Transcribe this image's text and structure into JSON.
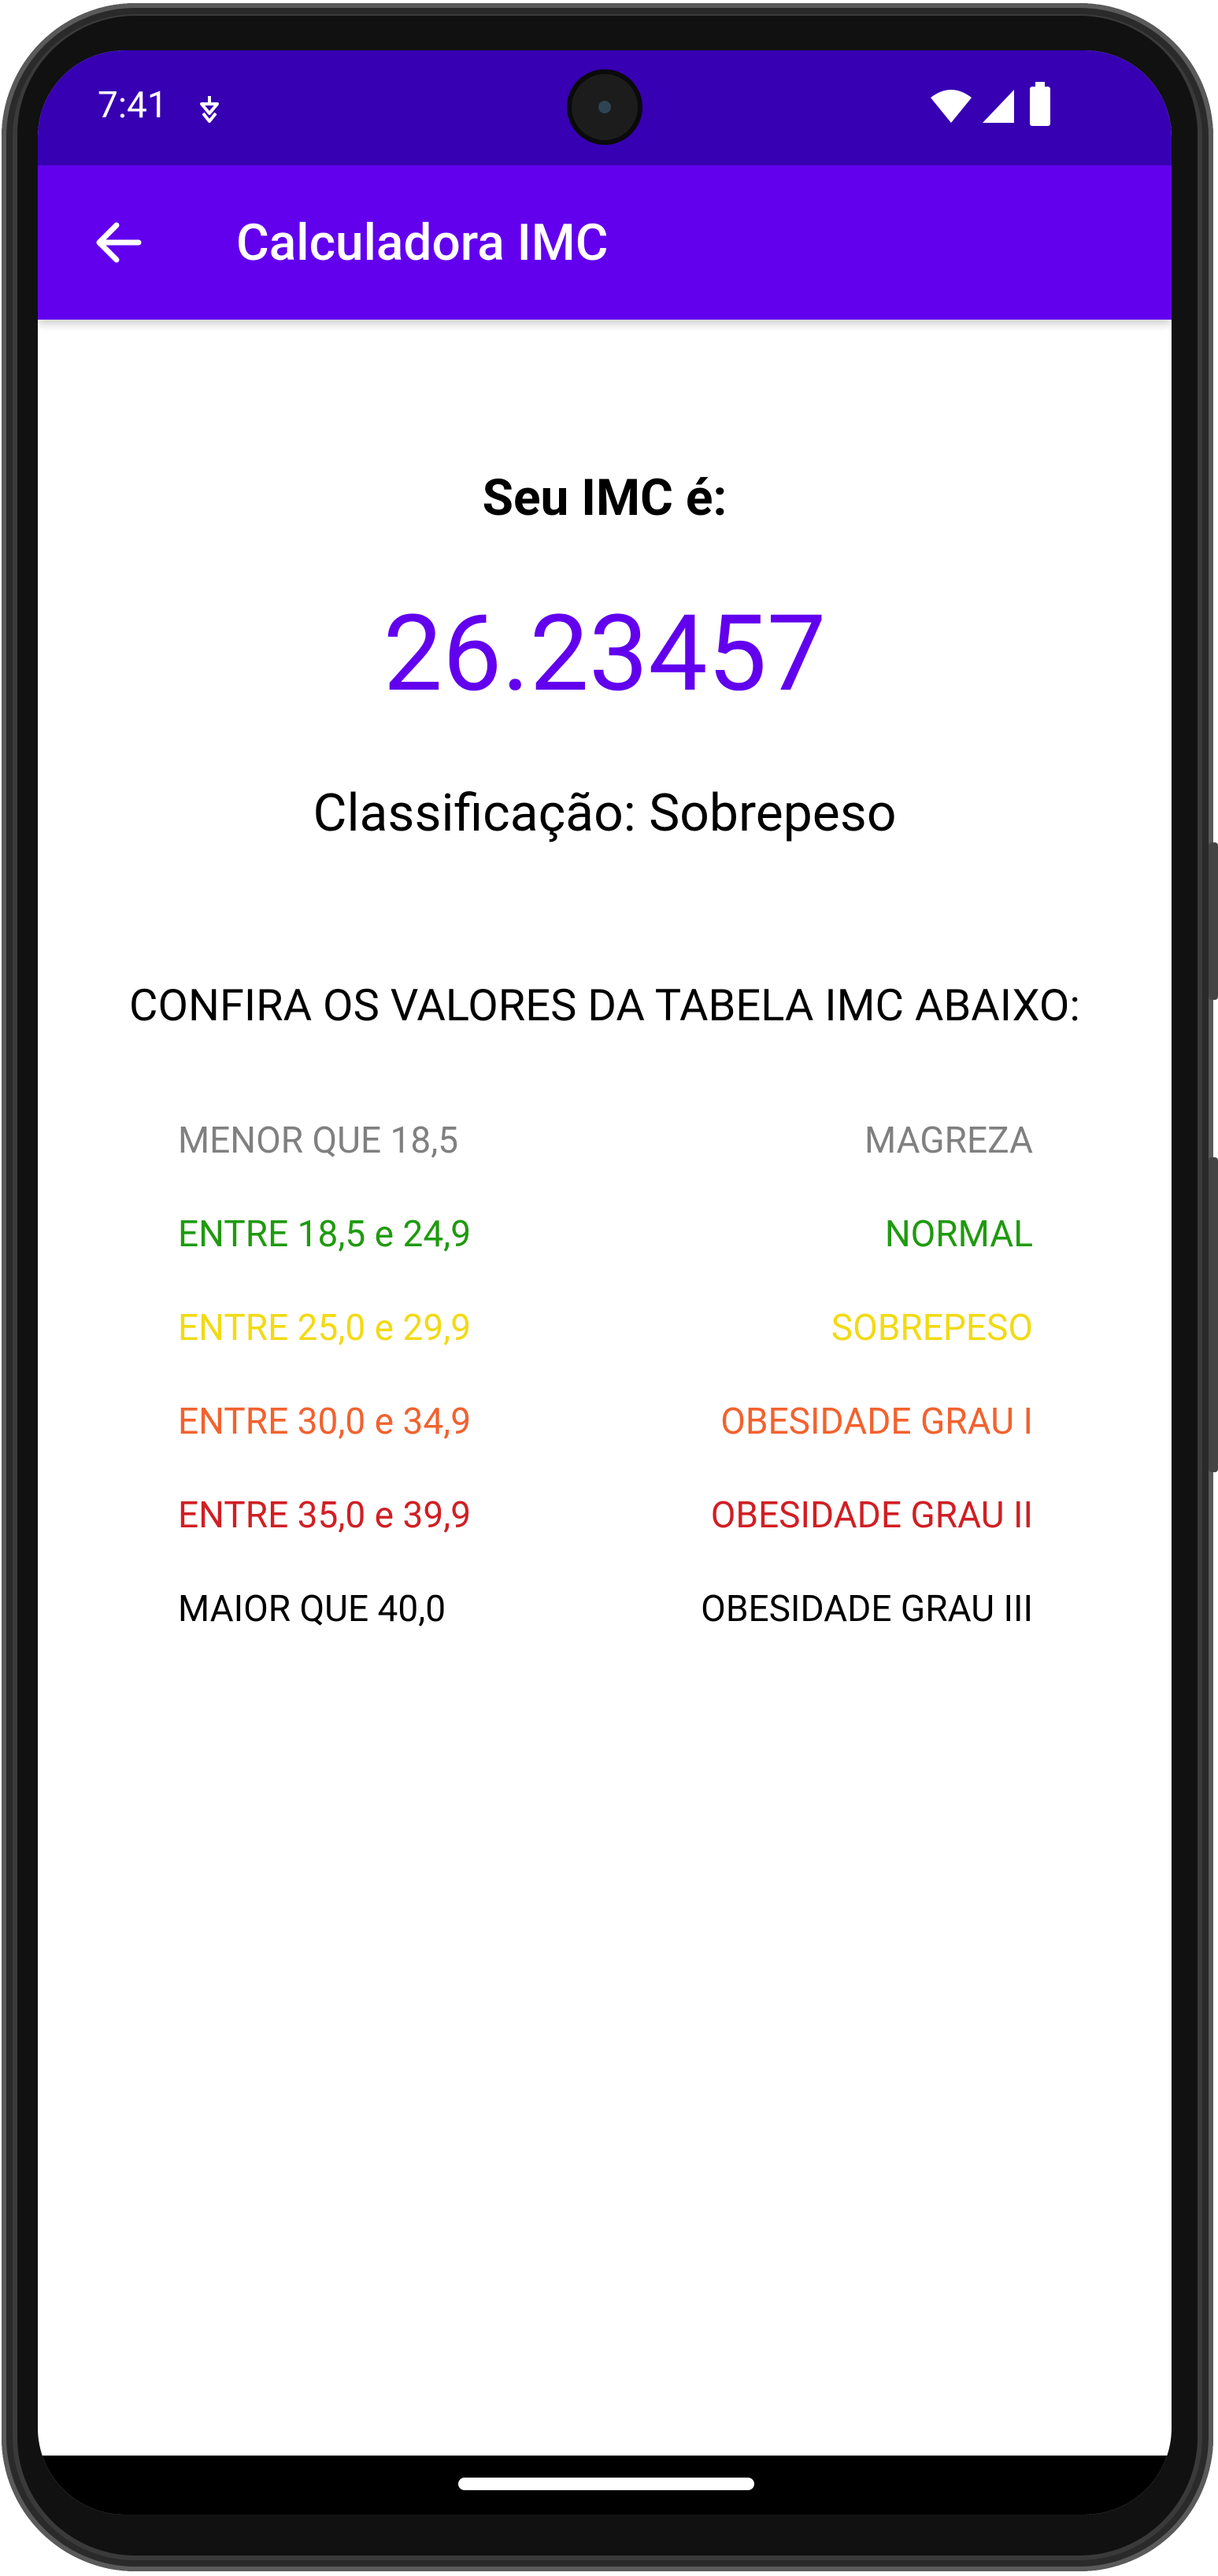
{
  "status_bar": {
    "time": "7:41",
    "icons": [
      "notification-icon",
      "wifi-icon",
      "signal-icon",
      "battery-icon"
    ]
  },
  "app_bar": {
    "title": "Calculadora IMC",
    "back_icon": "arrow-left-icon"
  },
  "result": {
    "label": "Seu IMC é:",
    "value": "26.23457",
    "classification": "Classificação: Sobrepeso"
  },
  "table": {
    "heading": "CONFIRA OS VALORES DA TABELA IMC ABAIXO:",
    "rows": [
      {
        "range": "MENOR QUE 18,5",
        "category": "MAGREZA",
        "color": "#808080"
      },
      {
        "range": "ENTRE 18,5 e 24,9",
        "category": "NORMAL",
        "color": "#1f9a0e"
      },
      {
        "range": "ENTRE 25,0 e 29,9",
        "category": "SOBREPESO",
        "color": "#f2da14"
      },
      {
        "range": "ENTRE 30,0 e 34,9",
        "category": "OBESIDADE GRAU I",
        "color": "#f2622f"
      },
      {
        "range": "ENTRE 35,0 e 39,9",
        "category": "OBESIDADE GRAU II",
        "color": "#d01f24"
      },
      {
        "range": "MAIOR QUE 40,0",
        "category": "OBESIDADE GRAU III",
        "color": "#000000"
      }
    ]
  },
  "colors": {
    "status_bar": "#3700b3",
    "app_bar": "#6200ee",
    "accent": "#6200ee"
  }
}
